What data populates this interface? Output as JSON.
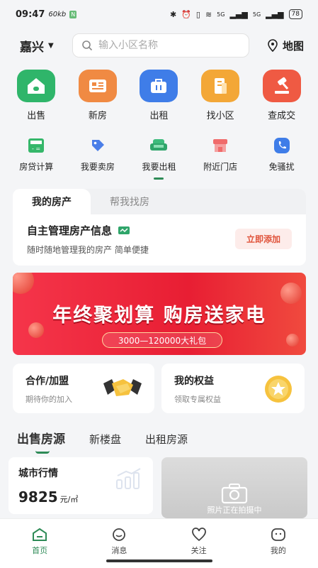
{
  "status": {
    "time": "09:47",
    "net": "60kb",
    "nfc": "N",
    "battery": "78",
    "sig1": "5G",
    "sig2": "5G"
  },
  "header": {
    "city": "嘉兴",
    "search_placeholder": "输入小区名称",
    "map_label": "地图"
  },
  "main_icons": [
    {
      "label": "出售",
      "icon": "house-icon",
      "color": "#2fb56a"
    },
    {
      "label": "新房",
      "icon": "building-card-icon",
      "color": "#f08a43"
    },
    {
      "label": "出租",
      "icon": "bag-icon",
      "color": "#3f7de8"
    },
    {
      "label": "找小区",
      "icon": "building-icon",
      "color": "#f3a737"
    },
    {
      "label": "查成交",
      "icon": "gavel-icon",
      "color": "#ef5a43"
    }
  ],
  "sub_icons": [
    {
      "label": "房贷计算",
      "icon": "calculator-icon"
    },
    {
      "label": "我要卖房",
      "icon": "tag-icon"
    },
    {
      "label": "我要出租",
      "icon": "sofa-icon"
    },
    {
      "label": "附近门店",
      "icon": "store-icon"
    },
    {
      "label": "免骚扰",
      "icon": "phone-icon"
    }
  ],
  "property": {
    "tabs": [
      "我的房产",
      "帮我找房"
    ],
    "title": "自主管理房产信息",
    "subtitle": "随时随地管理我的房产 简单便捷",
    "button": "立即添加"
  },
  "banner": {
    "title": "年终聚划算 购房送家电",
    "pill": "3000—120000大礼包"
  },
  "promos": [
    {
      "title": "合作/加盟",
      "subtitle": "期待你的加入",
      "icon": "handshake-icon"
    },
    {
      "title": "我的权益",
      "subtitle": "领取专属权益",
      "icon": "star-badge-icon"
    }
  ],
  "list_tabs": [
    "出售房源",
    "新楼盘",
    "出租房源"
  ],
  "market": {
    "title": "城市行情",
    "price": "9825",
    "unit": "元/㎡"
  },
  "photo": {
    "caption": "照片正在拍摄中"
  },
  "bottom_nav": [
    {
      "label": "首页",
      "icon": "home-icon"
    },
    {
      "label": "消息",
      "icon": "message-icon"
    },
    {
      "label": "关注",
      "icon": "heart-icon"
    },
    {
      "label": "我的",
      "icon": "profile-icon"
    }
  ],
  "colors": {
    "accent": "#2e8b57",
    "banner_red": "#e81e33"
  }
}
